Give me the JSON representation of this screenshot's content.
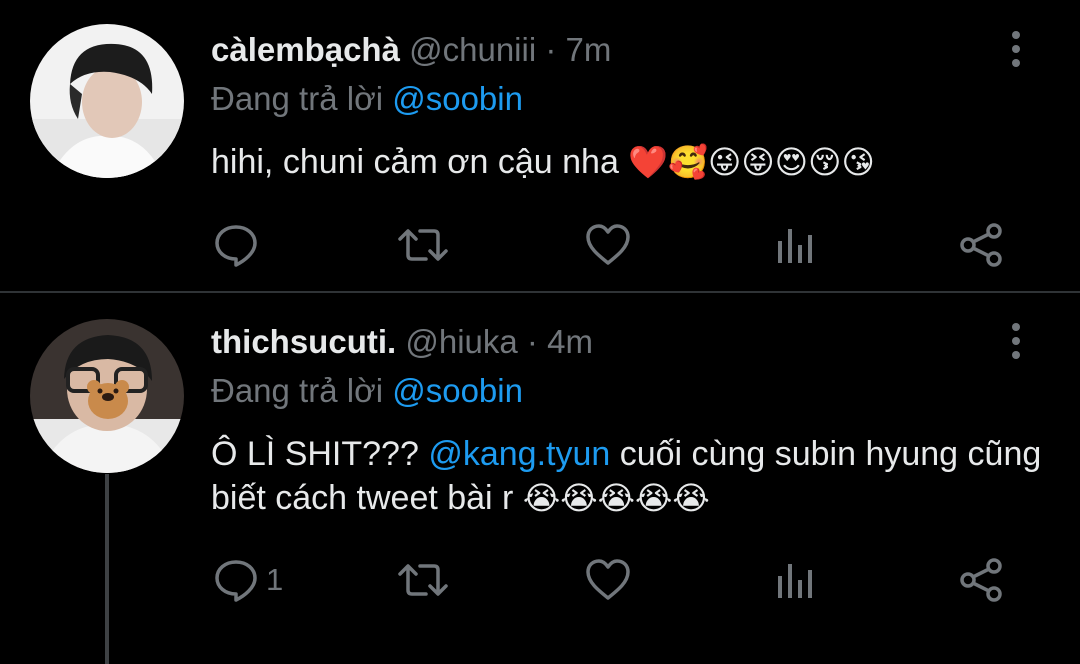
{
  "tweets": [
    {
      "display_name": "càlembạchà",
      "handle": "@chuniii",
      "separator": "·",
      "time": "7m",
      "reply_prefix": "Đang trả lời",
      "reply_mention": "@soobin",
      "text": "hihi, chuni cảm ơn cậu nha",
      "emojis": "❤️🥰😜😝😍😚😘",
      "reply_count": ""
    },
    {
      "display_name": "thichsucuti.",
      "handle": "@hiuka",
      "separator": "·",
      "time": "4m",
      "reply_prefix": "Đang trả lời",
      "reply_mention": "@soobin",
      "text_before": "Ô LÌ SHIT???",
      "text_mention": "@kang.tyun",
      "text_after": "cuối cùng subin hyung cũng biết cách tweet bài r",
      "emojis": "😭😭😭😭😭",
      "reply_count": "1"
    }
  ],
  "icons": [
    "reply-icon",
    "retweet-icon",
    "like-icon",
    "analytics-icon",
    "share-icon",
    "more-options-icon"
  ],
  "colors": {
    "background": "#000000",
    "text": "#e7e9ea",
    "secondary": "#71767b",
    "accent": "#1d9bf0",
    "divider": "#2f3336"
  }
}
